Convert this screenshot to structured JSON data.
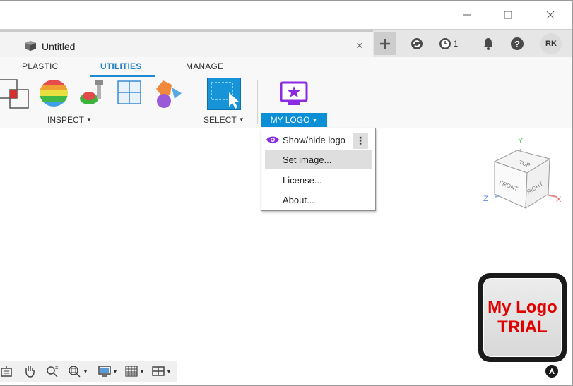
{
  "window": {
    "minimize_icon": "minimize-icon",
    "maximize_icon": "maximize-icon",
    "close_icon": "close-icon"
  },
  "tabbar": {
    "document_title": "Untitled",
    "close_glyph": "×",
    "jobs_count": "1",
    "user_initials": "RK"
  },
  "ribbon": {
    "tabs": [
      {
        "label": "PLASTIC",
        "active": false
      },
      {
        "label": "UTILITIES",
        "active": true
      },
      {
        "label": "MANAGE",
        "active": false
      }
    ],
    "groups": {
      "inspect": "INSPECT",
      "select": "SELECT",
      "mylogo": "MY LOGO"
    },
    "caret": "▼"
  },
  "mylogo_menu": {
    "items": [
      {
        "label": "Show/hide logo",
        "icon": "eye-icon"
      },
      {
        "label": "Set image...",
        "highlighted": true
      },
      {
        "label": "License..."
      },
      {
        "label": "About..."
      }
    ],
    "more_glyph": "⋮"
  },
  "viewcube": {
    "top": "TOP",
    "front": "FRONT",
    "right": "RIGHT",
    "axis_x": "X",
    "axis_y": "Y",
    "axis_z": "Z"
  },
  "logo_badge": {
    "line1": "My Logo",
    "line2": "TRIAL"
  },
  "colors": {
    "accent": "#1f8ad1",
    "mylogo_button": "#0b8fd6",
    "logo_text": "#e00000",
    "purple": "#8a2be2"
  }
}
